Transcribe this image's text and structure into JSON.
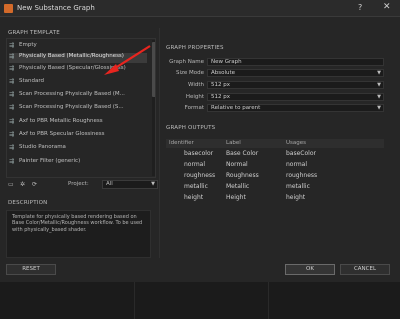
{
  "window": {
    "title": "New Substance Graph",
    "help_glyph": "?",
    "close_glyph": "✕"
  },
  "template_section": {
    "title": "GRAPH TEMPLATE",
    "items": [
      {
        "label": "Empty",
        "icon": "graph-icon"
      },
      {
        "label": "Physically Based (Metallic/Roughness)",
        "icon": "graph-icon",
        "selected": true
      },
      {
        "label": "Physically Based (Specular/Glossiness)",
        "icon": "graph-icon"
      },
      {
        "label": "Standard",
        "icon": "graph-icon"
      },
      {
        "label": "Scan Processing Physically Based (M...",
        "icon": "graph-icon"
      },
      {
        "label": "Scan Processing Physically Based (S...",
        "icon": "graph-icon"
      },
      {
        "label": "Axf to PBR Metallic Roughness",
        "icon": "graph-icon"
      },
      {
        "label": "Axf to PBR Specular Glossiness",
        "icon": "graph-icon"
      },
      {
        "label": "Studio Panorama",
        "icon": "graph-icon"
      },
      {
        "label": "Painter Filter (generic)",
        "icon": "graph-icon"
      }
    ],
    "project_label": "Project:",
    "project_value": "All"
  },
  "description": {
    "title": "DESCRIPTION",
    "text": "Template for physically based rendering based on Base Color/Metallic/Roughness workflow. To be used with physically_based shader."
  },
  "properties": {
    "title": "GRAPH PROPERTIES",
    "rows": [
      {
        "label": "Graph Name",
        "value": "New Graph",
        "dropdown": false
      },
      {
        "label": "Size Mode",
        "value": "Absolute",
        "dropdown": true
      },
      {
        "label": "Width",
        "value": "512 px",
        "dropdown": true
      },
      {
        "label": "Height",
        "value": "512 px",
        "dropdown": true
      },
      {
        "label": "Format",
        "value": "Relative to parent",
        "dropdown": true
      }
    ]
  },
  "outputs": {
    "title": "GRAPH OUTPUTS",
    "headers": [
      "Identifier",
      "Label",
      "Usages"
    ],
    "rows": [
      [
        "basecolor",
        "Base Color",
        "baseColor"
      ],
      [
        "normal",
        "Normal",
        "normal"
      ],
      [
        "roughness",
        "Roughness",
        "roughness"
      ],
      [
        "metallic",
        "Metallic",
        "metallic"
      ],
      [
        "height",
        "Height",
        "height"
      ]
    ]
  },
  "buttons": {
    "reset": "RESET",
    "ok": "OK",
    "cancel": "CANCEL"
  },
  "colors": {
    "annotation_arrow": "#e8251f",
    "app_icon": "#d36a2a"
  }
}
